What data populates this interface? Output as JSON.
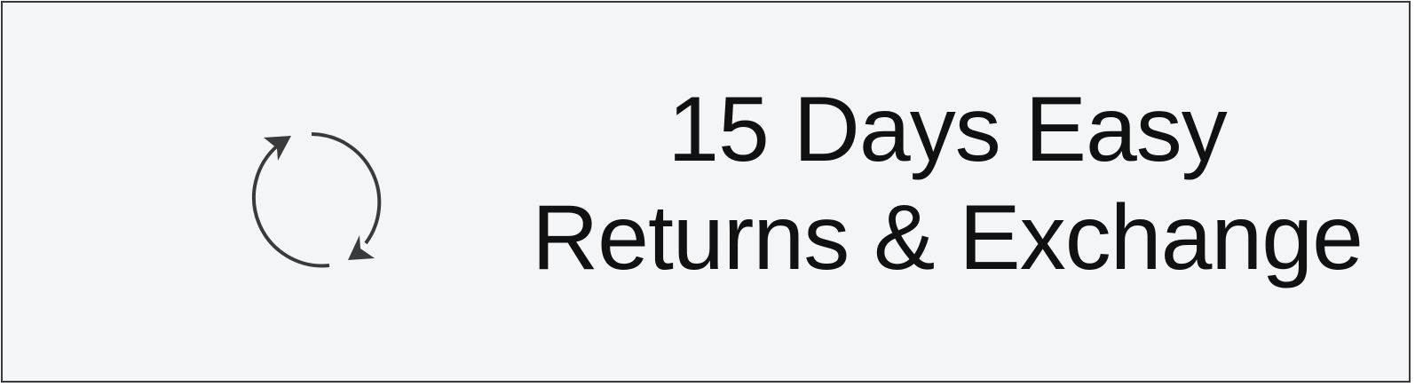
{
  "promo": {
    "line1": "15 Days Easy",
    "line2": "Returns & Exchange",
    "icon": "refresh-cycle-icon"
  },
  "colors": {
    "background": "#f4f5f7",
    "border": "#3a3a3a",
    "icon": "#3a3a3a",
    "text": "#111111"
  }
}
